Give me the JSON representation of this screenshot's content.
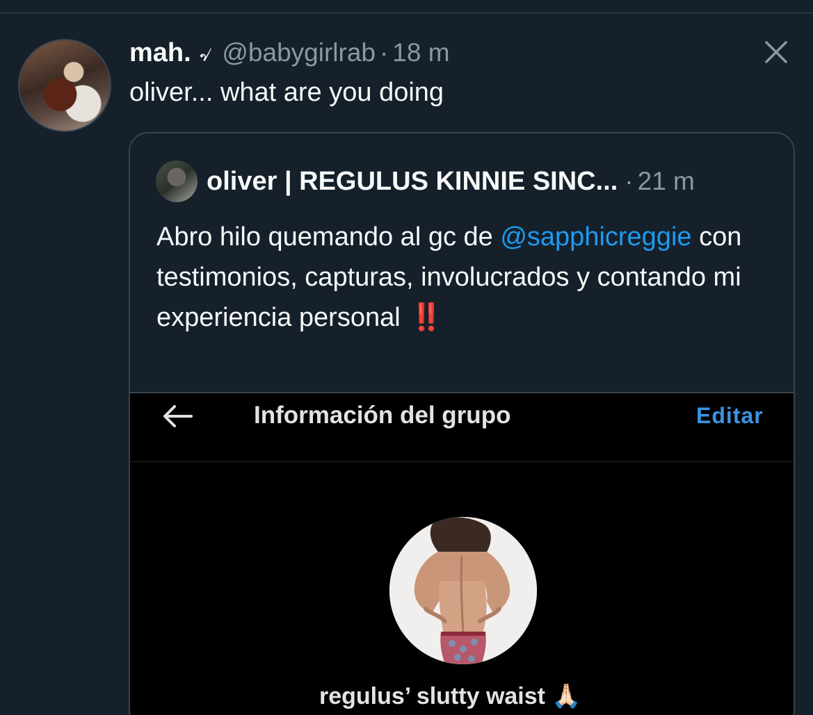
{
  "tweet": {
    "author_name": "mah.",
    "author_emoji": "৵",
    "handle": "@babygirlrab",
    "separator": "·",
    "time": "18 m",
    "text": "oliver... what are you doing"
  },
  "quote": {
    "author_name": "oliver | REGULUS KINNIE SINC...",
    "separator": "·",
    "time": "21 m",
    "text_part1": "Abro hilo quemando al gc de ",
    "mention": "@sapphicreggie",
    "text_part2": " con testimonios, capturas, involucrados y contando mi experiencia personal",
    "emphasis_emoji": "‼️"
  },
  "embedded_screenshot": {
    "title": "Información del grupo",
    "edit_label": "Editar",
    "group_name": "regulus’ slutty waist 🙏🏻"
  },
  "colors": {
    "background": "#15202b",
    "secondary_text": "#8b98a5",
    "link": "#1d9bf0",
    "edit_link": "#3b93e4",
    "border": "#38444d"
  },
  "icons": {
    "close": "close-icon",
    "back": "back-arrow-icon"
  }
}
